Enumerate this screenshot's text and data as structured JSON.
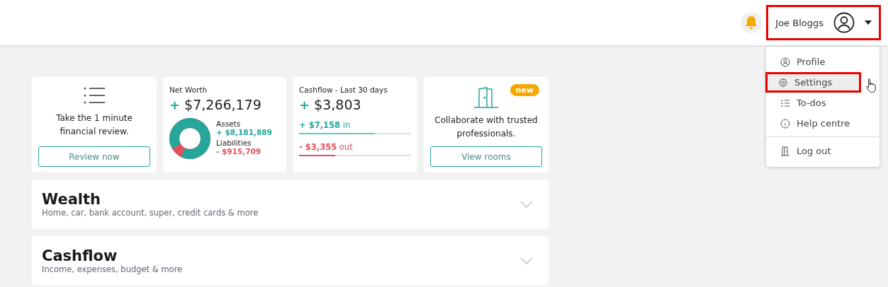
{
  "header": {
    "user_name": "Joe Bloggs",
    "highlighted": true
  },
  "user_menu": {
    "items": [
      {
        "label": "Profile",
        "kind": "profile",
        "selected": false,
        "highlighted": false
      },
      {
        "label": "Settings",
        "kind": "settings",
        "selected": true,
        "highlighted": true
      },
      {
        "label": "To-dos",
        "kind": "todos",
        "selected": false,
        "highlighted": false
      },
      {
        "label": "Help centre",
        "kind": "help",
        "selected": false,
        "highlighted": false
      },
      {
        "label": "Log out",
        "kind": "logout",
        "selected": false,
        "highlighted": false
      }
    ]
  },
  "review_card": {
    "text": "Take the 1 minute financial review.",
    "button": "Review now"
  },
  "net_worth_card": {
    "title": "Net Worth",
    "sign": "+",
    "amount": "$7,266,179",
    "assets_label": "Assets",
    "assets": "+ $8,181,889",
    "liabilities_label": "Liabilities",
    "liabilities": "- $915,709"
  },
  "cashflow_card": {
    "title": "Cashflow - Last 30 days",
    "sign": "+",
    "amount": "$3,803",
    "flows": [
      {
        "kind": "in",
        "amount": "+ $7,158",
        "label": "in",
        "level": 0.68
      },
      {
        "kind": "out",
        "amount": "- $3,355",
        "label": "out",
        "level": 0.32
      }
    ]
  },
  "rooms_card": {
    "badge": "new",
    "text": "Collaborate with trusted professionals.",
    "button": "View rooms"
  },
  "sections": [
    {
      "title": "Wealth",
      "subtitle": "Home, car, bank account, super, credit cards & more",
      "expanded": false
    },
    {
      "title": "Cashflow",
      "subtitle": "Income, expenses, budget & more",
      "expanded": false
    }
  ]
}
